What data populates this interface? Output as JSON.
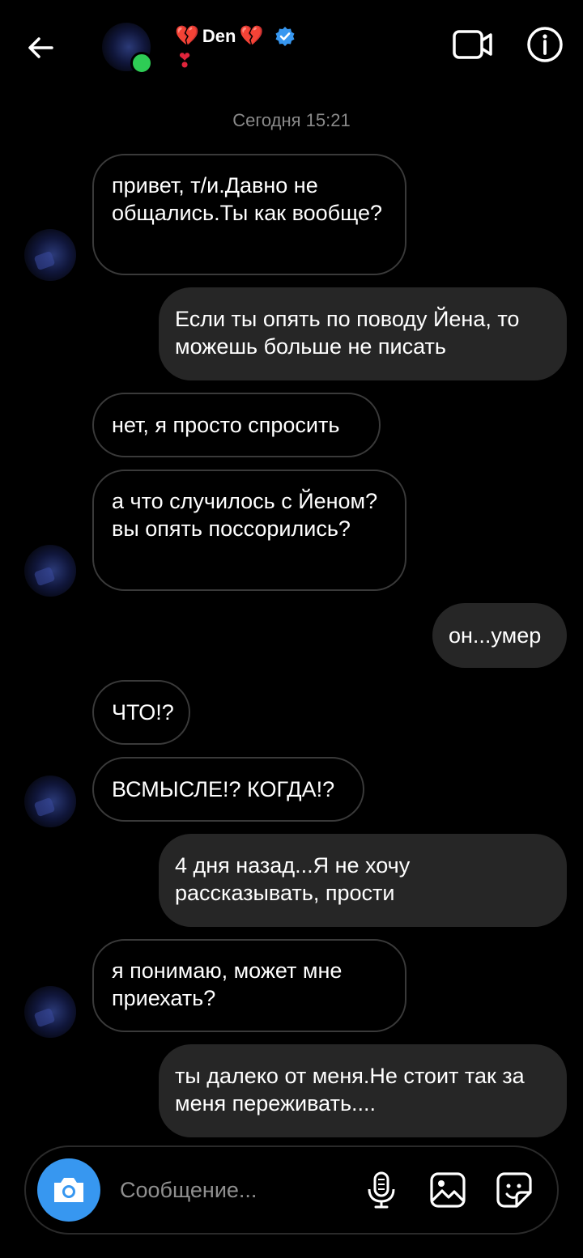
{
  "header": {
    "name": "Den",
    "name_prefix_emoji": "💔",
    "name_suffix_emoji": "💔",
    "subtitle_emoji": "❣"
  },
  "timestamp": "Сегодня 15:21",
  "messages": [
    {
      "dir": "in",
      "text": "привет, т/и.Давно не общались.Ты как вообще?"
    },
    {
      "dir": "out",
      "text": "Если ты опять по поводу Йена, то можешь больше не писать"
    },
    {
      "dir": "in",
      "text": "нет, я просто спросить"
    },
    {
      "dir": "in",
      "text": "а что случилось с Йеном?вы опять поссорились?"
    },
    {
      "dir": "out",
      "text": "он...умер"
    },
    {
      "dir": "in",
      "text": "ЧТО!?"
    },
    {
      "dir": "in",
      "text": "ВСМЫСЛЕ!? КОГДА!?"
    },
    {
      "dir": "out",
      "text": "4 дня назад...Я не хочу рассказывать, прости"
    },
    {
      "dir": "in",
      "text": "я понимаю, может мне приехать?"
    },
    {
      "dir": "out",
      "text": "ты далеко от меня.Не стоит так за меня переживать...."
    }
  ],
  "composer": {
    "placeholder": "Сообщение..."
  },
  "icons": {
    "back": "arrow-left-icon",
    "video": "video-camera-icon",
    "info": "info-icon",
    "camera": "camera-icon",
    "mic": "microphone-icon",
    "gallery": "image-icon",
    "sticker": "sticker-icon",
    "verified": "verified-badge-icon"
  },
  "colors": {
    "background": "#000000",
    "outgoing_bubble": "#262626",
    "accent_blue": "#3797f0",
    "online_green": "#2ecc55",
    "heart_red": "#e0243b"
  }
}
